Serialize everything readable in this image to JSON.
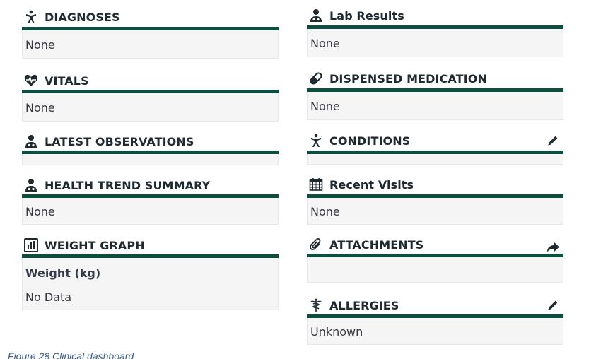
{
  "left": {
    "diagnoses": {
      "title": "DIAGNOSES",
      "value": "None",
      "icon": "person-stretch-icon"
    },
    "vitals": {
      "title": "VITALS",
      "value": "None",
      "icon": "heartbeat-icon"
    },
    "latest_observations": {
      "title": "LATEST OBSERVATIONS",
      "icon": "doctor-icon"
    },
    "health_trend_summary": {
      "title": "HEALTH TREND SUMMARY",
      "value": "None",
      "icon": "doctor-icon"
    },
    "weight_graph": {
      "title": "WEIGHT GRAPH",
      "subtitle": "Weight (kg)",
      "value": "No Data",
      "icon": "bar-chart-icon"
    }
  },
  "right": {
    "lab_results": {
      "title": "Lab Results",
      "value": "None",
      "icon": "doctor-icon"
    },
    "dispensed_medication": {
      "title": "DISPENSED MEDICATION",
      "value": "None",
      "icon": "pill-icon"
    },
    "conditions": {
      "title": "CONDITIONS",
      "icon": "person-stretch-icon",
      "action_icon": "pencil-icon"
    },
    "recent_visits": {
      "title": "Recent Visits",
      "value": "None",
      "icon": "calendar-icon"
    },
    "attachments": {
      "title": "ATTACHMENTS",
      "icon": "paperclip-icon",
      "action_icon": "share-arrow-icon"
    },
    "allergies": {
      "title": "ALLERGIES",
      "value": "Unknown",
      "icon": "caduceus-icon",
      "action_icon": "pencil-icon"
    }
  },
  "caption": "Figure 28 Clinical dashboard",
  "colors": {
    "accent": "#0d4f3f",
    "panel_bg": "#f5f5f5",
    "text": "#1f2a30"
  }
}
